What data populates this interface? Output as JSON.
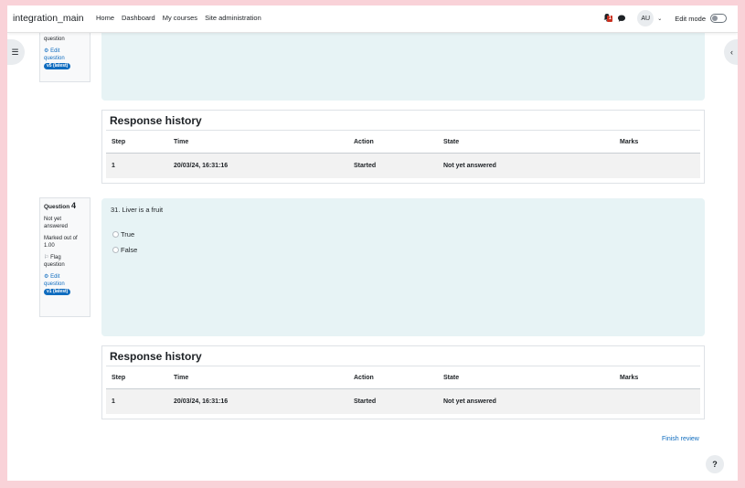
{
  "navbar": {
    "brand": "integration_main",
    "links": [
      "Home",
      "Dashboard",
      "My courses",
      "Site administration"
    ],
    "notification_count": "1",
    "avatar_initials": "AU",
    "edit_mode_label": "Edit mode"
  },
  "question3_info": {
    "partial_label": "question",
    "edit_label_1": "Edit",
    "edit_label_2": "question",
    "version": "v5 (latest)"
  },
  "question4_info": {
    "title_prefix": "Question",
    "number": "4",
    "state_1": "Not yet",
    "state_2": "answered",
    "marked_1": "Marked out of",
    "marked_2": "1.00",
    "flag_1": "Flag",
    "flag_2": "question",
    "edit_label_1": "Edit",
    "edit_label_2": "question",
    "version": "v1 (latest)"
  },
  "question4": {
    "text": "31. Liver is a fruit",
    "options": [
      "True",
      "False"
    ]
  },
  "response_history": {
    "title": "Response history",
    "headers": [
      "Step",
      "Time",
      "Action",
      "State",
      "Marks"
    ],
    "rows_q3": [
      [
        "1",
        "20/03/24, 16:31:16",
        "Started",
        "Not yet answered",
        ""
      ]
    ],
    "rows_q4": [
      [
        "1",
        "20/03/24, 16:31:16",
        "Started",
        "Not yet answered",
        ""
      ]
    ]
  },
  "footer": {
    "finish_review": "Finish review",
    "help_label": "?"
  }
}
